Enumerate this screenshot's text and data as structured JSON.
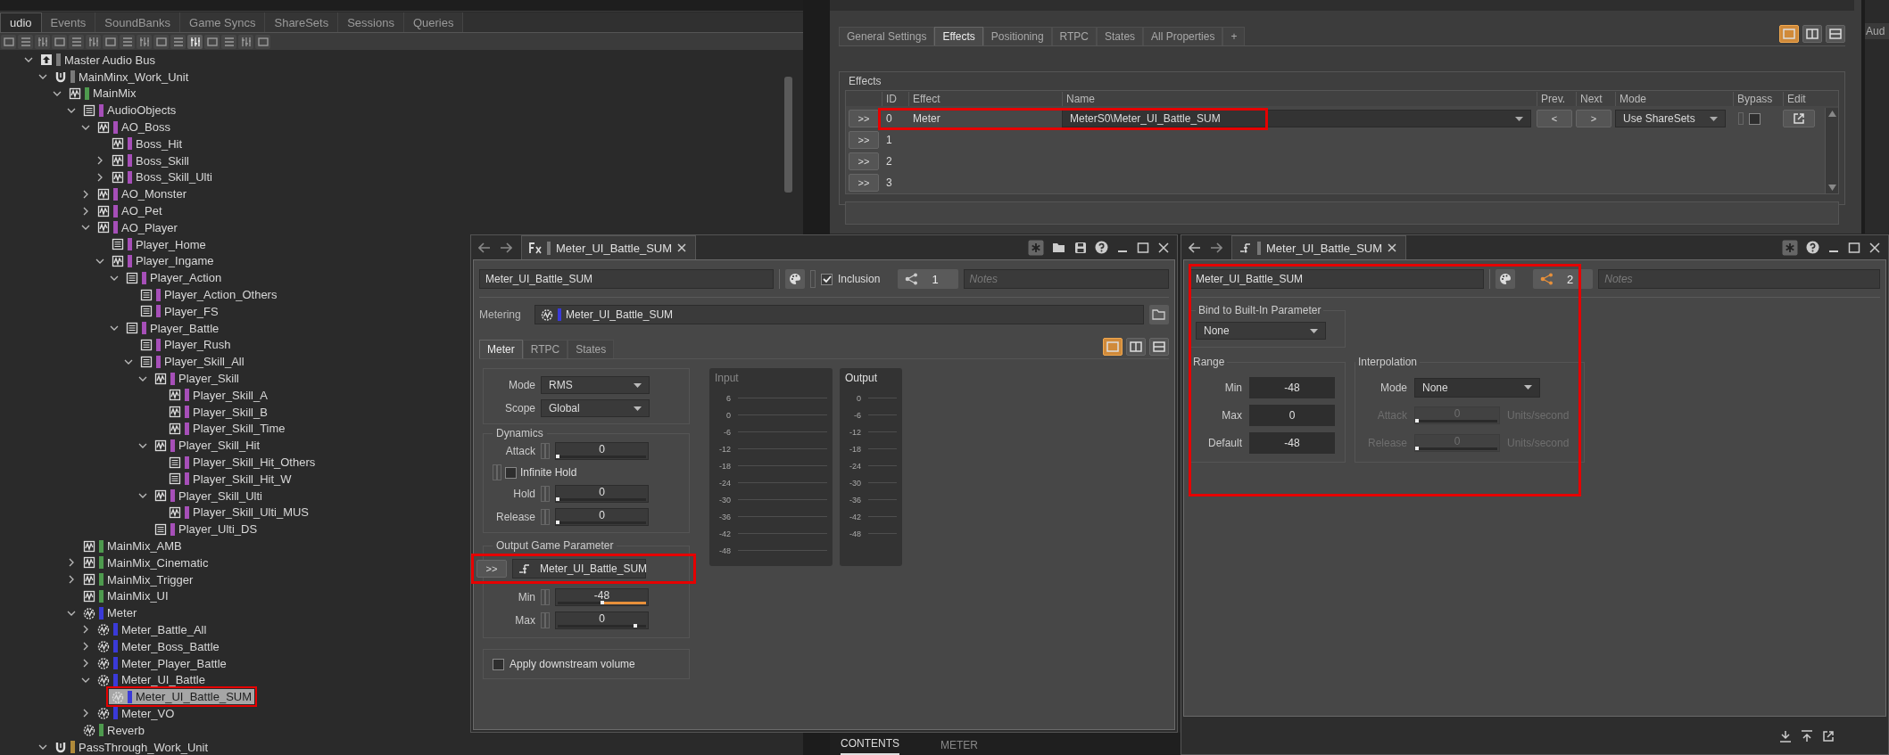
{
  "explorer": {
    "tabs": [
      {
        "label": "udio",
        "selected": true
      },
      {
        "label": "Events",
        "selected": false
      },
      {
        "label": "SoundBanks",
        "selected": false
      },
      {
        "label": "Game Syncs",
        "selected": false
      },
      {
        "label": "ShareSets",
        "selected": false
      },
      {
        "label": "Sessions",
        "selected": false
      },
      {
        "label": "Queries",
        "selected": false
      }
    ],
    "toolbar": [
      {
        "selected": false
      },
      {
        "selected": false
      },
      {
        "selected": false
      },
      {
        "selected": false
      },
      {
        "selected": false
      },
      {
        "selected": false
      },
      {
        "selected": false
      },
      {
        "selected": false
      },
      {
        "selected": false
      },
      {
        "selected": false
      },
      {
        "selected": false
      },
      {
        "selected": true
      },
      {
        "selected": false
      },
      {
        "selected": false
      },
      {
        "selected": false
      },
      {
        "selected": false
      }
    ],
    "tree": [
      {
        "name": "Master Audio Bus",
        "kind": "master",
        "color": "#7a7a7a",
        "expanded": true,
        "selected": false,
        "children": [
          {
            "name": "MainMinx_Work_Unit",
            "kind": "workunit",
            "color": "#7a7a7a",
            "expanded": true,
            "selected": false,
            "children": [
              {
                "name": "MainMix",
                "kind": "bus",
                "color": "#4e9a4e",
                "expanded": true,
                "selected": false,
                "children": [
                  {
                    "name": "AudioObjects",
                    "kind": "aux",
                    "color": "#a64fb8",
                    "expanded": true,
                    "selected": false,
                    "children": [
                      {
                        "name": "AO_Boss",
                        "kind": "bus",
                        "color": "#a64fb8",
                        "expanded": true,
                        "selected": false,
                        "children": [
                          {
                            "name": "Boss_Hit",
                            "kind": "bus",
                            "color": "#a64fb8",
                            "selected": false
                          },
                          {
                            "name": "Boss_Skill",
                            "kind": "bus",
                            "color": "#a64fb8",
                            "expanded": false,
                            "selected": false
                          },
                          {
                            "name": "Boss_Skill_Ulti",
                            "kind": "bus",
                            "color": "#a64fb8",
                            "expanded": false,
                            "selected": false
                          }
                        ]
                      },
                      {
                        "name": "AO_Monster",
                        "kind": "bus",
                        "color": "#a64fb8",
                        "expanded": false,
                        "selected": false
                      },
                      {
                        "name": "AO_Pet",
                        "kind": "bus",
                        "color": "#a64fb8",
                        "expanded": false,
                        "selected": false
                      },
                      {
                        "name": "AO_Player",
                        "kind": "bus",
                        "color": "#a64fb8",
                        "expanded": true,
                        "selected": false,
                        "children": [
                          {
                            "name": "Player_Home",
                            "kind": "aux",
                            "color": "#a64fb8",
                            "selected": false
                          },
                          {
                            "name": "Player_Ingame",
                            "kind": "bus",
                            "color": "#a64fb8",
                            "expanded": true,
                            "selected": false,
                            "children": [
                              {
                                "name": "Player_Action",
                                "kind": "aux",
                                "color": "#a64fb8",
                                "expanded": true,
                                "selected": false,
                                "children": [
                                  {
                                    "name": "Player_Action_Others",
                                    "kind": "aux",
                                    "color": "#a64fb8",
                                    "selected": false
                                  },
                                  {
                                    "name": "Player_FS",
                                    "kind": "aux",
                                    "color": "#a64fb8",
                                    "selected": false
                                  }
                                ]
                              },
                              {
                                "name": "Player_Battle",
                                "kind": "aux",
                                "color": "#a64fb8",
                                "expanded": true,
                                "selected": false,
                                "children": [
                                  {
                                    "name": "Player_Rush",
                                    "kind": "aux",
                                    "color": "#a64fb8",
                                    "selected": false
                                  },
                                  {
                                    "name": "Player_Skill_All",
                                    "kind": "aux",
                                    "color": "#a64fb8",
                                    "expanded": true,
                                    "selected": false,
                                    "children": [
                                      {
                                        "name": "Player_Skill",
                                        "kind": "bus",
                                        "color": "#a64fb8",
                                        "expanded": true,
                                        "selected": false,
                                        "children": [
                                          {
                                            "name": "Player_Skill_A",
                                            "kind": "bus",
                                            "color": "#a64fb8",
                                            "selected": false
                                          },
                                          {
                                            "name": "Player_Skill_B",
                                            "kind": "bus",
                                            "color": "#a64fb8",
                                            "selected": false
                                          },
                                          {
                                            "name": "Player_Skill_Time",
                                            "kind": "bus",
                                            "color": "#a64fb8",
                                            "selected": false
                                          }
                                        ]
                                      },
                                      {
                                        "name": "Player_Skill_Hit",
                                        "kind": "bus",
                                        "color": "#a64fb8",
                                        "expanded": true,
                                        "selected": false,
                                        "children": [
                                          {
                                            "name": "Player_Skill_Hit_Others",
                                            "kind": "aux",
                                            "color": "#a64fb8",
                                            "selected": false
                                          },
                                          {
                                            "name": "Player_Skill_Hit_W",
                                            "kind": "aux",
                                            "color": "#a64fb8",
                                            "selected": false
                                          }
                                        ]
                                      },
                                      {
                                        "name": "Player_Skill_Ulti",
                                        "kind": "bus",
                                        "color": "#a64fb8",
                                        "expanded": true,
                                        "selected": false,
                                        "children": [
                                          {
                                            "name": "Player_Skill_Ulti_MUS",
                                            "kind": "bus",
                                            "color": "#a64fb8",
                                            "selected": false
                                          }
                                        ]
                                      },
                                      {
                                        "name": "Player_Ulti_DS",
                                        "kind": "aux",
                                        "color": "#a64fb8",
                                        "selected": false
                                      }
                                    ]
                                  }
                                ]
                              }
                            ]
                          }
                        ]
                      }
                    ]
                  },
                  {
                    "name": "MainMix_AMB",
                    "kind": "bus",
                    "color": "#4e9a4e",
                    "selected": false
                  },
                  {
                    "name": "MainMix_Cinematic",
                    "kind": "bus",
                    "color": "#4e9a4e",
                    "expanded": false,
                    "selected": false
                  },
                  {
                    "name": "MainMix_Trigger",
                    "kind": "bus",
                    "color": "#4e9a4e",
                    "expanded": false,
                    "selected": false
                  },
                  {
                    "name": "MainMix_UI",
                    "kind": "bus",
                    "color": "#4e9a4e",
                    "selected": false
                  },
                  {
                    "name": "Meter",
                    "kind": "meter",
                    "color": "#3a3ad8",
                    "expanded": true,
                    "selected": false,
                    "children": [
                      {
                        "name": "Meter_Battle_All",
                        "kind": "meter",
                        "color": "#3a3ad8",
                        "expanded": false,
                        "selected": false
                      },
                      {
                        "name": "Meter_Boss_Battle",
                        "kind": "meter",
                        "color": "#3a3ad8",
                        "expanded": false,
                        "selected": false
                      },
                      {
                        "name": "Meter_Player_Battle",
                        "kind": "meter",
                        "color": "#3a3ad8",
                        "expanded": false,
                        "selected": false
                      },
                      {
                        "name": "Meter_UI_Battle",
                        "kind": "meter",
                        "color": "#3a3ad8",
                        "expanded": true,
                        "selected": false,
                        "children": [
                          {
                            "name": "Meter_UI_Battle_SUM",
                            "kind": "meter",
                            "color": "#3a3ad8",
                            "selected": true
                          }
                        ]
                      },
                      {
                        "name": "Meter_VO",
                        "kind": "meter",
                        "color": "#3a3ad8",
                        "expanded": false,
                        "selected": false
                      }
                    ]
                  },
                  {
                    "name": "Reverb",
                    "kind": "meter",
                    "color": "#4e9a4e",
                    "selected": false
                  }
                ]
              }
            ]
          },
          {
            "name": "PassThrough_Work_Unit",
            "kind": "workunit",
            "color": "#b08a3a",
            "expanded": true,
            "selected": false
          }
        ]
      }
    ]
  },
  "property_editor": {
    "tabs": [
      {
        "label": "General Settings",
        "selected": false
      },
      {
        "label": "Effects",
        "selected": true
      },
      {
        "label": "Positioning",
        "selected": false
      },
      {
        "label": "RTPC",
        "selected": false
      },
      {
        "label": "States",
        "selected": false
      },
      {
        "label": "All Properties",
        "selected": false
      },
      {
        "label": "+",
        "selected": false
      }
    ],
    "layout_buttons": [
      {
        "selected": true
      },
      {
        "selected": false
      },
      {
        "selected": false
      }
    ],
    "effects": {
      "title": "Effects",
      "columns": [
        "ID",
        "Effect",
        "Name",
        "Prev.",
        "Next",
        "Mode",
        "Bypass",
        "Edit"
      ],
      "rows": [
        {
          "button": ">>",
          "id": "0",
          "effect": "Meter",
          "name": "MeterS0\\Meter_UI_Battle_SUM",
          "prev": "<",
          "next": ">",
          "mode": "Use ShareSets",
          "bypass": false
        },
        {
          "button": ">>",
          "id": "1"
        },
        {
          "button": ">>",
          "id": "2"
        },
        {
          "button": ">>",
          "id": "3"
        }
      ]
    }
  },
  "side_panel": {
    "tab": "Aud"
  },
  "bottom_tabs": [
    {
      "label": "CONTENTS",
      "selected": true
    },
    {
      "label": "METER",
      "selected": false
    }
  ],
  "meter_window": {
    "tab_title": "Meter_UI_Battle_SUM",
    "name": "Meter_UI_Battle_SUM",
    "inclusion": {
      "label": "Inclusion",
      "checked": true
    },
    "references": "1",
    "notes_placeholder": "Notes",
    "metering": {
      "label": "Metering",
      "value": "Meter_UI_Battle_SUM"
    },
    "tabs": [
      {
        "label": "Meter",
        "selected": true
      },
      {
        "label": "RTPC",
        "selected": false
      },
      {
        "label": "States",
        "selected": false
      }
    ],
    "layout_buttons": [
      {
        "selected": true
      },
      {
        "selected": false
      },
      {
        "selected": false
      }
    ],
    "mode": {
      "label": "Mode",
      "value": "RMS"
    },
    "scope": {
      "label": "Scope",
      "value": "Global"
    },
    "dynamics": {
      "title": "Dynamics",
      "attack": {
        "label": "Attack",
        "value": "0",
        "level": 0,
        "highlight": false
      },
      "infinite_hold": {
        "label": "Infinite Hold",
        "checked": false
      },
      "hold": {
        "label": "Hold",
        "value": "0",
        "level": 0,
        "highlight": false
      },
      "release": {
        "label": "Release",
        "value": "0",
        "level": 0,
        "highlight": false
      }
    },
    "output_game_parameter": {
      "title": "Output Game Parameter",
      "button": ">>",
      "value": "Meter_UI_Battle_SUM",
      "min": {
        "label": "Min",
        "value": "-48",
        "level": 0.5,
        "highlight": true
      },
      "max": {
        "label": "Max",
        "value": "0",
        "level": 0.88,
        "highlight": false
      }
    },
    "apply_downstream": {
      "label": "Apply downstream volume",
      "checked": false
    },
    "input_meter": {
      "title": "Input",
      "ticks": [
        "6",
        "0",
        "-6",
        "-12",
        "-18",
        "-24",
        "-30",
        "-36",
        "-42",
        "-48"
      ]
    },
    "output_meter": {
      "title": "Output",
      "ticks": [
        "0",
        "-6",
        "-12",
        "-18",
        "-24",
        "-30",
        "-36",
        "-42",
        "-48"
      ]
    }
  },
  "rtpc_window": {
    "tab_title": "Meter_UI_Battle_SUM",
    "name": "Meter_UI_Battle_SUM",
    "references": "2",
    "notes_placeholder": "Notes",
    "bind": {
      "title": "Bind to Built-In Parameter",
      "value": "None"
    },
    "range": {
      "title": "Range",
      "fields": [
        {
          "label": "Min",
          "value": "-48"
        },
        {
          "label": "Max",
          "value": "0"
        },
        {
          "label": "Default",
          "value": "-48"
        }
      ]
    },
    "interpolation": {
      "title": "Interpolation",
      "mode": {
        "label": "Mode",
        "value": "None"
      },
      "rows": [
        {
          "label": "Attack",
          "value": "0",
          "unit": "Units/second",
          "disabled": true,
          "level": 0
        },
        {
          "label": "Release",
          "value": "0",
          "unit": "Units/second",
          "disabled": true,
          "level": 0
        }
      ]
    }
  }
}
